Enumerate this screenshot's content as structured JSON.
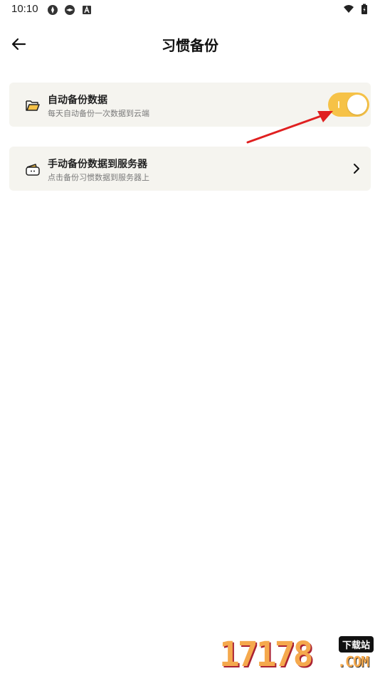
{
  "status_bar": {
    "time": "10:10"
  },
  "header": {
    "title": "习惯备份"
  },
  "settings": [
    {
      "title": "自动备份数据",
      "subtitle": "每天自动备份一次数据到云端",
      "icon": "folder-icon",
      "toggle_on": true
    },
    {
      "title": "手动备份数据到服务器",
      "subtitle": "点击备份习惯数据到服务器上",
      "icon": "wallet-icon"
    }
  ],
  "watermark": {
    "digits": "17178",
    "badge": "下载站",
    "domain": ".COM"
  },
  "colors": {
    "accent": "#f6c247",
    "card_bg": "#f5f4ef",
    "annotation": "#e02020"
  }
}
